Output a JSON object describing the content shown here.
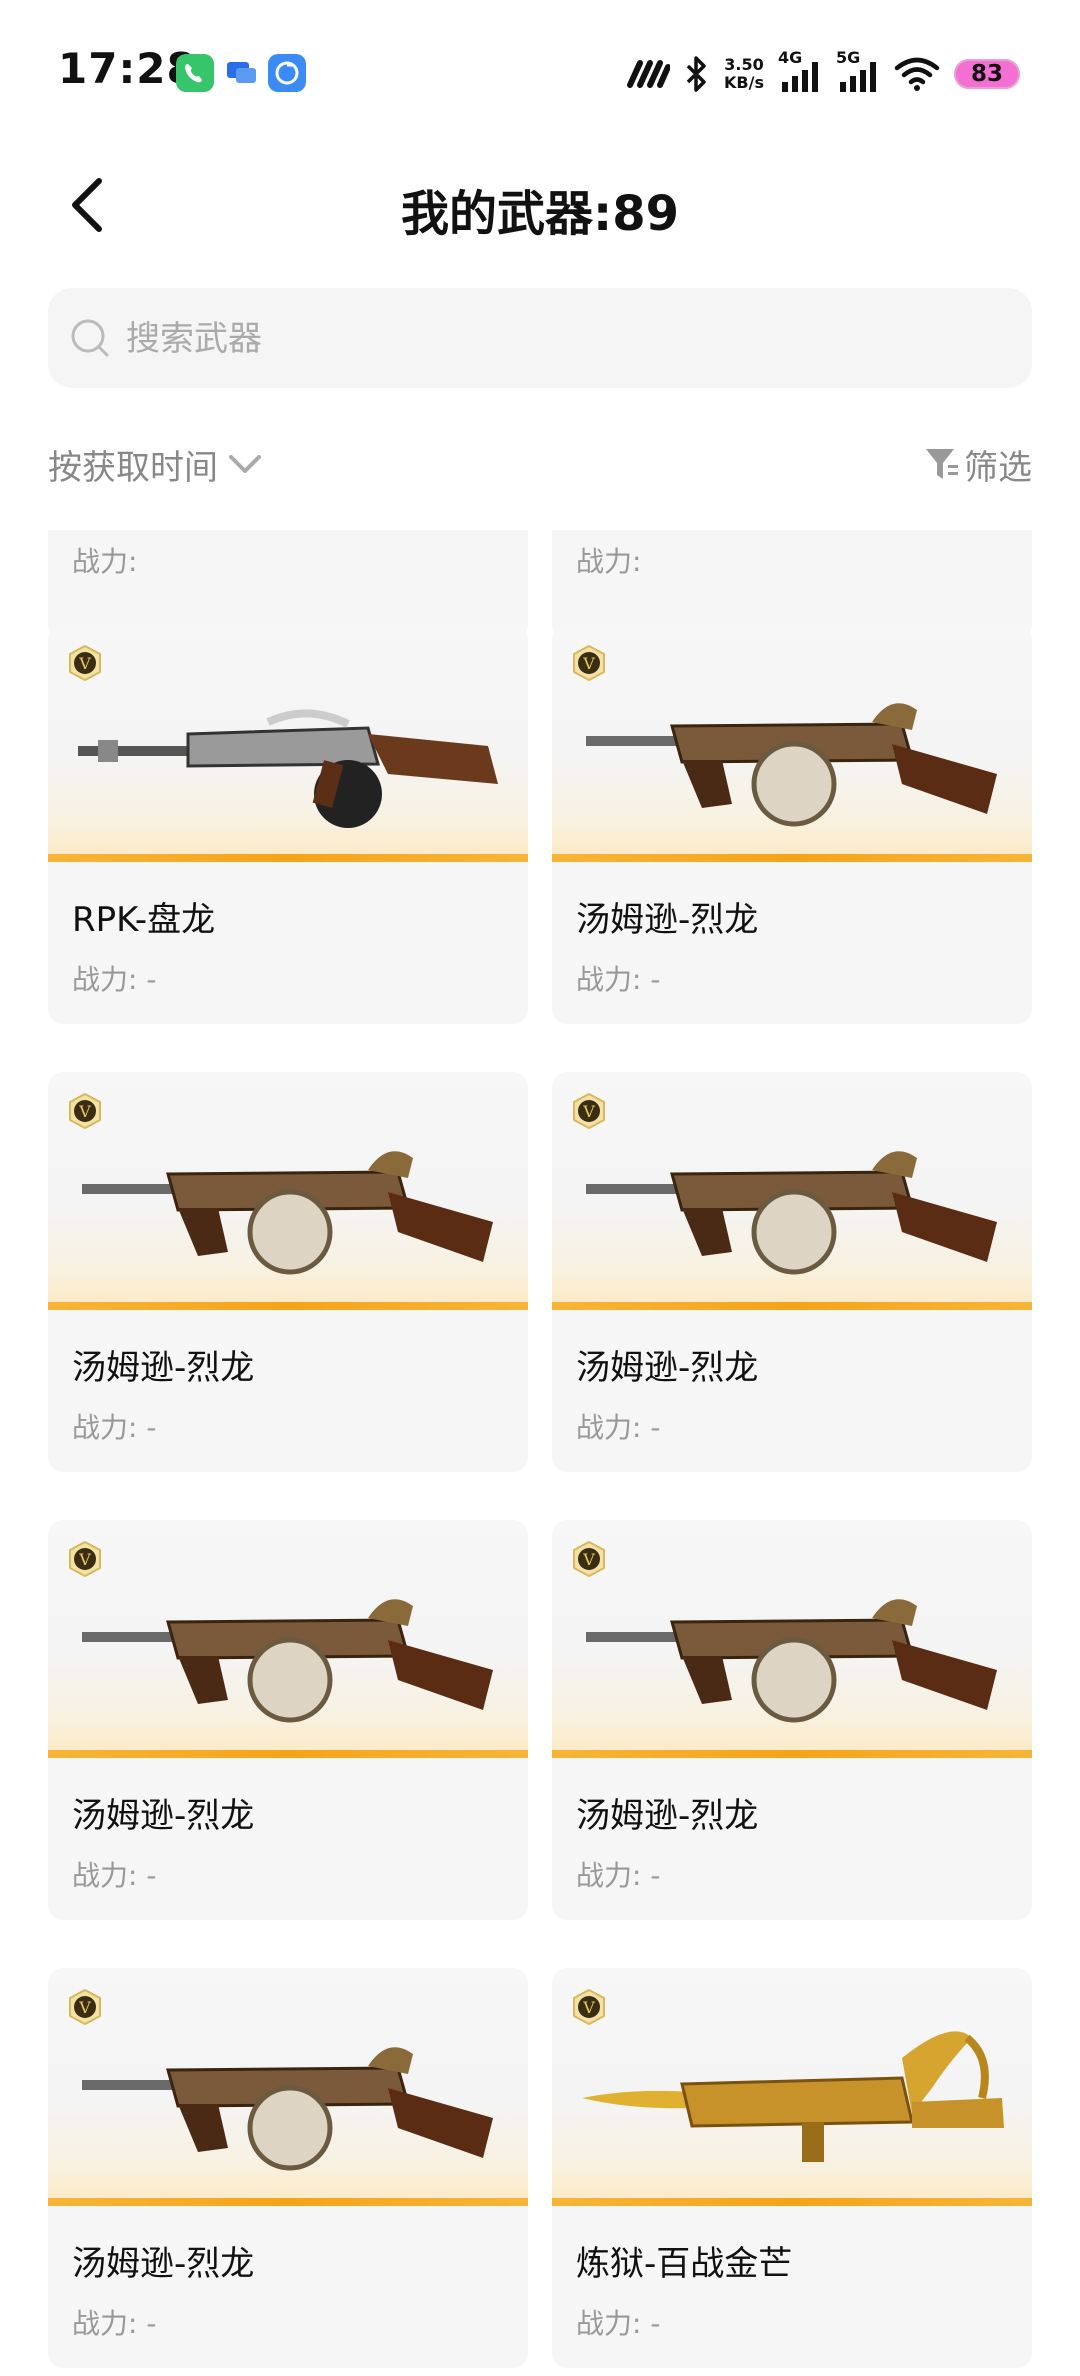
{
  "status_bar": {
    "time": "17:28",
    "speed_value": "3.50",
    "speed_unit": "KB/s",
    "net1": "4G",
    "net2": "5G",
    "battery": "83",
    "icons": [
      "phone-app-icon",
      "message-app-icon",
      "cloud-app-icon",
      "signal-icon",
      "bluetooth-icon",
      "wifi-icon"
    ]
  },
  "header": {
    "title": "我的武器:89"
  },
  "search": {
    "placeholder": "搜索武器",
    "value": ""
  },
  "toolbar": {
    "sort_label": "按获取时间",
    "filter_label": "筛选"
  },
  "weapons": [
    {
      "name": "",
      "power": "战力:"
    },
    {
      "name": "",
      "power": "战力:"
    },
    {
      "name": "RPK-盘龙",
      "power": "战力: -",
      "icon": "rifle-icon"
    },
    {
      "name": "汤姆逊-烈龙",
      "power": "战力: -",
      "icon": "smg-icon"
    },
    {
      "name": "汤姆逊-烈龙",
      "power": "战力: -",
      "icon": "smg-icon"
    },
    {
      "name": "汤姆逊-烈龙",
      "power": "战力: -",
      "icon": "smg-icon"
    },
    {
      "name": "汤姆逊-烈龙",
      "power": "战力: -",
      "icon": "smg-icon"
    },
    {
      "name": "汤姆逊-烈龙",
      "power": "战力: -",
      "icon": "smg-icon"
    },
    {
      "name": "汤姆逊-烈龙",
      "power": "战力: -",
      "icon": "smg-icon"
    },
    {
      "name": "炼狱-百战金芒",
      "power": "战力: -",
      "icon": "golden-rifle-icon"
    }
  ],
  "badge_letter": "V",
  "colors": {
    "accent_bar": "#f4a41a",
    "battery": "#f36fd2",
    "muted_text": "#888888"
  }
}
